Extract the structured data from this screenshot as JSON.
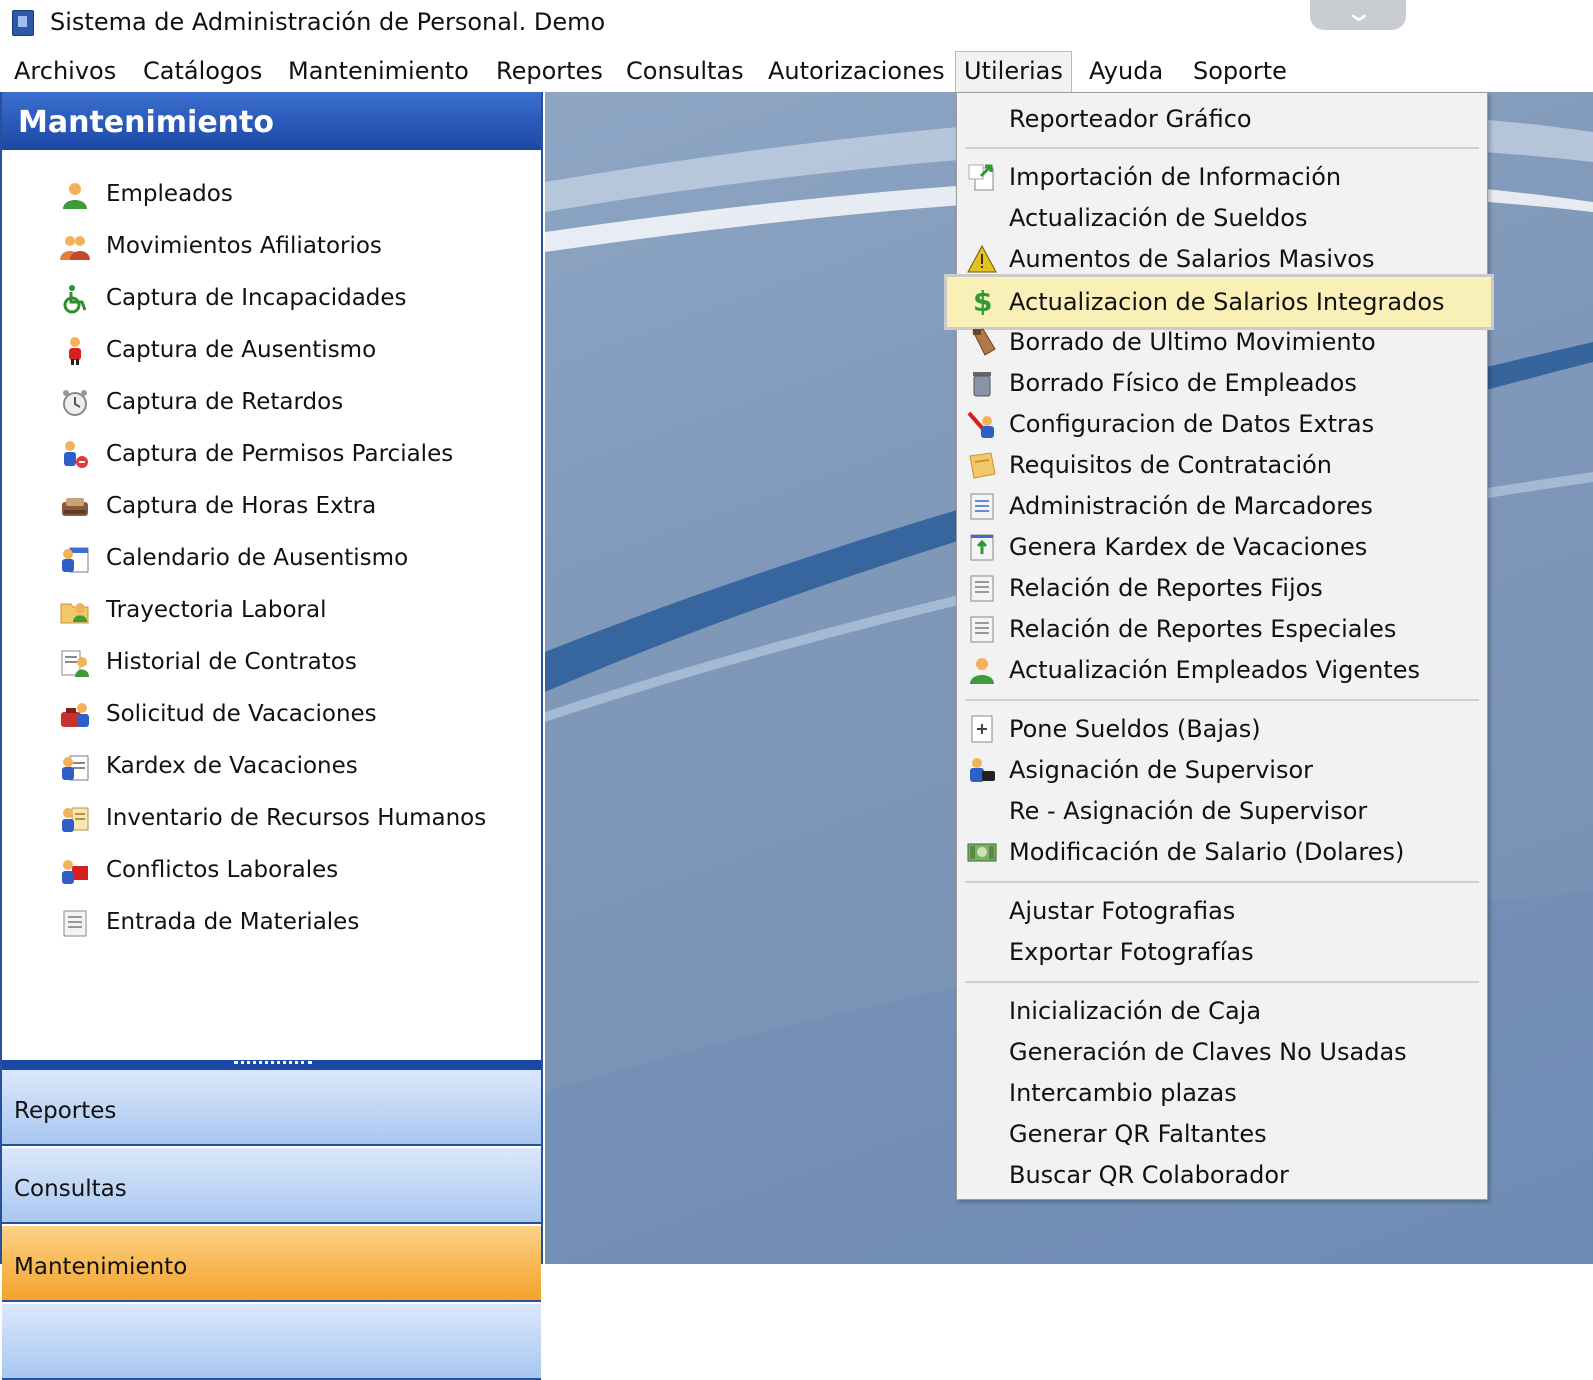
{
  "window": {
    "title": "Sistema de Administración de Personal. Demo"
  },
  "menubar": {
    "items": [
      {
        "label": "Archivos"
      },
      {
        "label": "Catálogos"
      },
      {
        "label": "Mantenimiento"
      },
      {
        "label": "Reportes"
      },
      {
        "label": "Consultas"
      },
      {
        "label": "Autorizaciones"
      },
      {
        "label": "Utilerias"
      },
      {
        "label": "Ayuda"
      },
      {
        "label": "Soporte"
      }
    ],
    "open_menu": "Utilerias"
  },
  "sidebar": {
    "header": "Mantenimiento",
    "items": [
      {
        "label": "Empleados",
        "icon": "person-icon"
      },
      {
        "label": "Movimientos Afiliatorios",
        "icon": "people-icon"
      },
      {
        "label": "Captura de Incapacidades",
        "icon": "wheelchair-icon"
      },
      {
        "label": "Captura de Ausentismo",
        "icon": "person-red-icon"
      },
      {
        "label": "Captura de Retardos",
        "icon": "alarm-clock-icon"
      },
      {
        "label": "Captura de Permisos Parciales",
        "icon": "person-permit-icon"
      },
      {
        "label": "Captura de Horas Extra",
        "icon": "hours-extra-icon"
      },
      {
        "label": "Calendario de Ausentismo",
        "icon": "calendar-icon"
      },
      {
        "label": "Trayectoria Laboral",
        "icon": "folder-person-icon"
      },
      {
        "label": "Historial de Contratos",
        "icon": "contract-history-icon"
      },
      {
        "label": "Solicitud de Vacaciones",
        "icon": "vacation-request-icon"
      },
      {
        "label": "Kardex de Vacaciones",
        "icon": "kardex-icon"
      },
      {
        "label": "Inventario de Recursos Humanos",
        "icon": "inventory-icon"
      },
      {
        "label": "Conflictos Laborales",
        "icon": "conflict-icon"
      },
      {
        "label": "Entrada de Materiales",
        "icon": "document-icon"
      }
    ],
    "groups": [
      {
        "label": "Reportes",
        "active": false
      },
      {
        "label": "Consultas",
        "active": false
      },
      {
        "label": "Mantenimiento",
        "active": true
      }
    ]
  },
  "utilerias_menu": {
    "items": [
      {
        "label": "Reporteador Gráfico",
        "icon": ""
      },
      {
        "label": "Importación de Información",
        "icon": "import-icon"
      },
      {
        "label": "Actualización de Sueldos",
        "icon": ""
      },
      {
        "label": "Aumentos de Salarios Masivos",
        "icon": "warning-triangle-icon"
      },
      {
        "label": "Actualizacion de Salarios Integrados",
        "icon": "dollar-icon",
        "highlighted": true
      },
      {
        "label": "Borrado de Ultimo Movimiento",
        "icon": "eraser-icon"
      },
      {
        "label": "Borrado Físico de Empleados",
        "icon": "trash-icon"
      },
      {
        "label": "Configuracion de Datos Extras",
        "icon": "config-extras-icon"
      },
      {
        "label": "Requisitos de Contratación",
        "icon": "requirements-icon"
      },
      {
        "label": "Administración de Marcadores",
        "icon": "checklist-icon"
      },
      {
        "label": "Genera Kardex de Vacaciones",
        "icon": "kardex-generate-icon"
      },
      {
        "label": "Relación de Reportes Fijos",
        "icon": "report-list-icon"
      },
      {
        "label": "Relación de Reportes Especiales",
        "icon": "report-list-icon"
      },
      {
        "label": "Actualización Empleados Vigentes",
        "icon": "person-icon"
      },
      {
        "label": "Pone Sueldos (Bajas)",
        "icon": "page-plus-icon"
      },
      {
        "label": "Asignación de Supervisor",
        "icon": "supervisor-icon"
      },
      {
        "label": "Re - Asignación de Supervisor",
        "icon": ""
      },
      {
        "label": "Modificación de Salario (Dolares)",
        "icon": "money-bill-icon"
      },
      {
        "label": "Ajustar Fotografias",
        "icon": ""
      },
      {
        "label": "Exportar Fotografías",
        "icon": ""
      },
      {
        "label": "Inicialización de Caja",
        "icon": ""
      },
      {
        "label": "Generación de Claves No Usadas",
        "icon": ""
      },
      {
        "label": "Intercambio plazas",
        "icon": ""
      },
      {
        "label": "Generar QR Faltantes",
        "icon": ""
      },
      {
        "label": "Buscar QR Colaborador",
        "icon": ""
      }
    ]
  },
  "colors": {
    "sidebar_header": "#1c48a5",
    "active_group": "#f3a22b",
    "highlight": "#f9f0b7"
  }
}
